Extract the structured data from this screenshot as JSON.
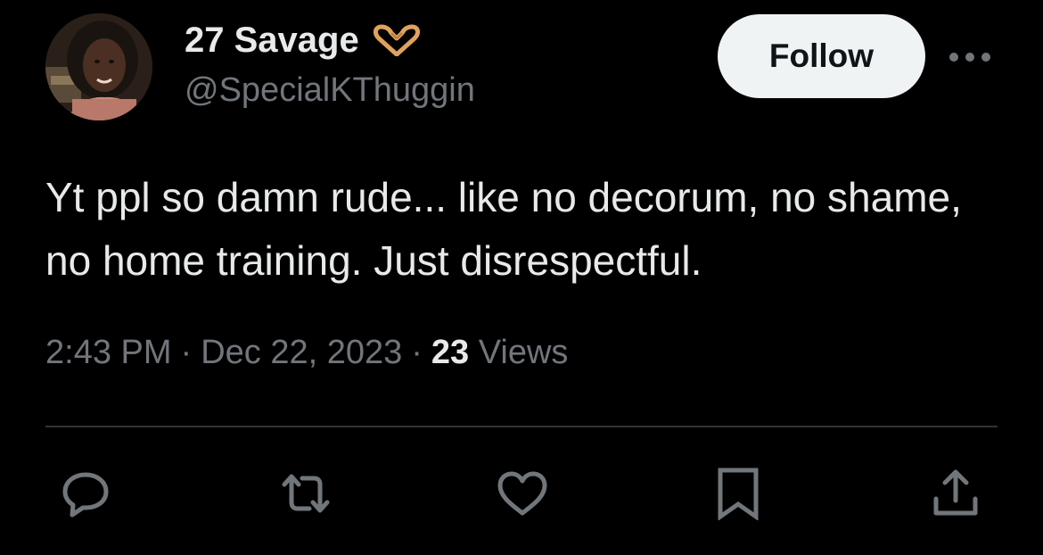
{
  "tweet": {
    "author": {
      "display_name": "27 Savage",
      "handle": "@SpecialKThuggin",
      "badge_icon": "heart-hands-emoji",
      "avatar": "profile-photo"
    },
    "follow_label": "Follow",
    "more_icon": "ellipsis-icon",
    "text": "Yt ppl so damn rude... like no decorum, no shame, no home training. Just disrespectful.",
    "time": "2:43 PM",
    "separator": "·",
    "date": "Dec 22, 2023",
    "views_count": "23",
    "views_label": "Views"
  },
  "actions": [
    {
      "icon": "reply-icon"
    },
    {
      "icon": "retweet-icon"
    },
    {
      "icon": "like-icon"
    },
    {
      "icon": "bookmark-icon"
    },
    {
      "icon": "share-icon"
    }
  ],
  "colors": {
    "background": "#000000",
    "primary_text": "#e7e9ea",
    "secondary_text": "#71767b",
    "divider": "#2f3336",
    "follow_button_bg": "#eff3f4",
    "follow_button_text": "#0f1419",
    "emoji_hand": "#e0a25c"
  }
}
